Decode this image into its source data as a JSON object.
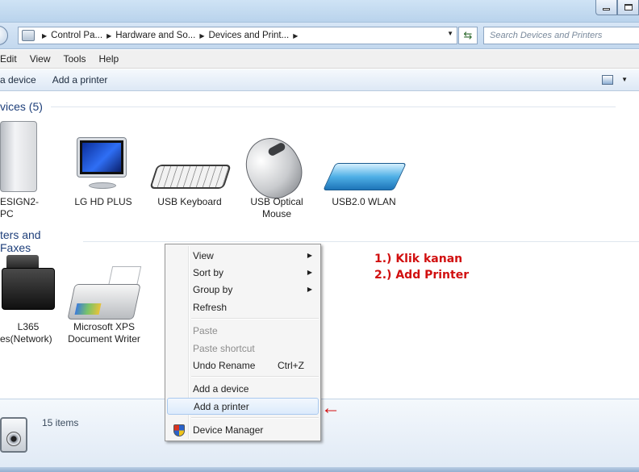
{
  "address": {
    "crumbs": [
      "Control Pa...",
      "Hardware and So...",
      "Devices and Print..."
    ],
    "search_placeholder": "Search Devices and Printers"
  },
  "menu": [
    "Edit",
    "View",
    "Tools",
    "Help"
  ],
  "commands": [
    "a device",
    "Add a printer"
  ],
  "groups": {
    "devices_title": "vices (5)",
    "printers_title": "ters and Faxes"
  },
  "devices": [
    {
      "label": "ESIGN2-PC"
    },
    {
      "label": "LG HD PLUS"
    },
    {
      "label": "USB Keyboard"
    },
    {
      "label_line1": "USB Optical",
      "label_line2": "Mouse"
    },
    {
      "label": "USB2.0 WLAN"
    }
  ],
  "printers": [
    {
      "label_line1": "L365",
      "label_line2": "es(Network)"
    },
    {
      "label_line1": "Microsoft XPS",
      "label_line2": "Document Writer"
    }
  ],
  "context_menu": {
    "view": "View",
    "sort_by": "Sort by",
    "group_by": "Group by",
    "refresh": "Refresh",
    "paste": "Paste",
    "paste_shortcut": "Paste shortcut",
    "undo_rename": "Undo Rename",
    "undo_shortcut": "Ctrl+Z",
    "add_device": "Add a device",
    "add_printer": "Add a printer",
    "device_manager": "Device Manager"
  },
  "annotation": {
    "line1": "1.) Klik kanan",
    "line2": "2.) Add Printer",
    "arrow": "←"
  },
  "details": {
    "count": "15 items"
  },
  "colors": {
    "annotation": "#d10f0f",
    "group_header": "#1e3f7a"
  }
}
